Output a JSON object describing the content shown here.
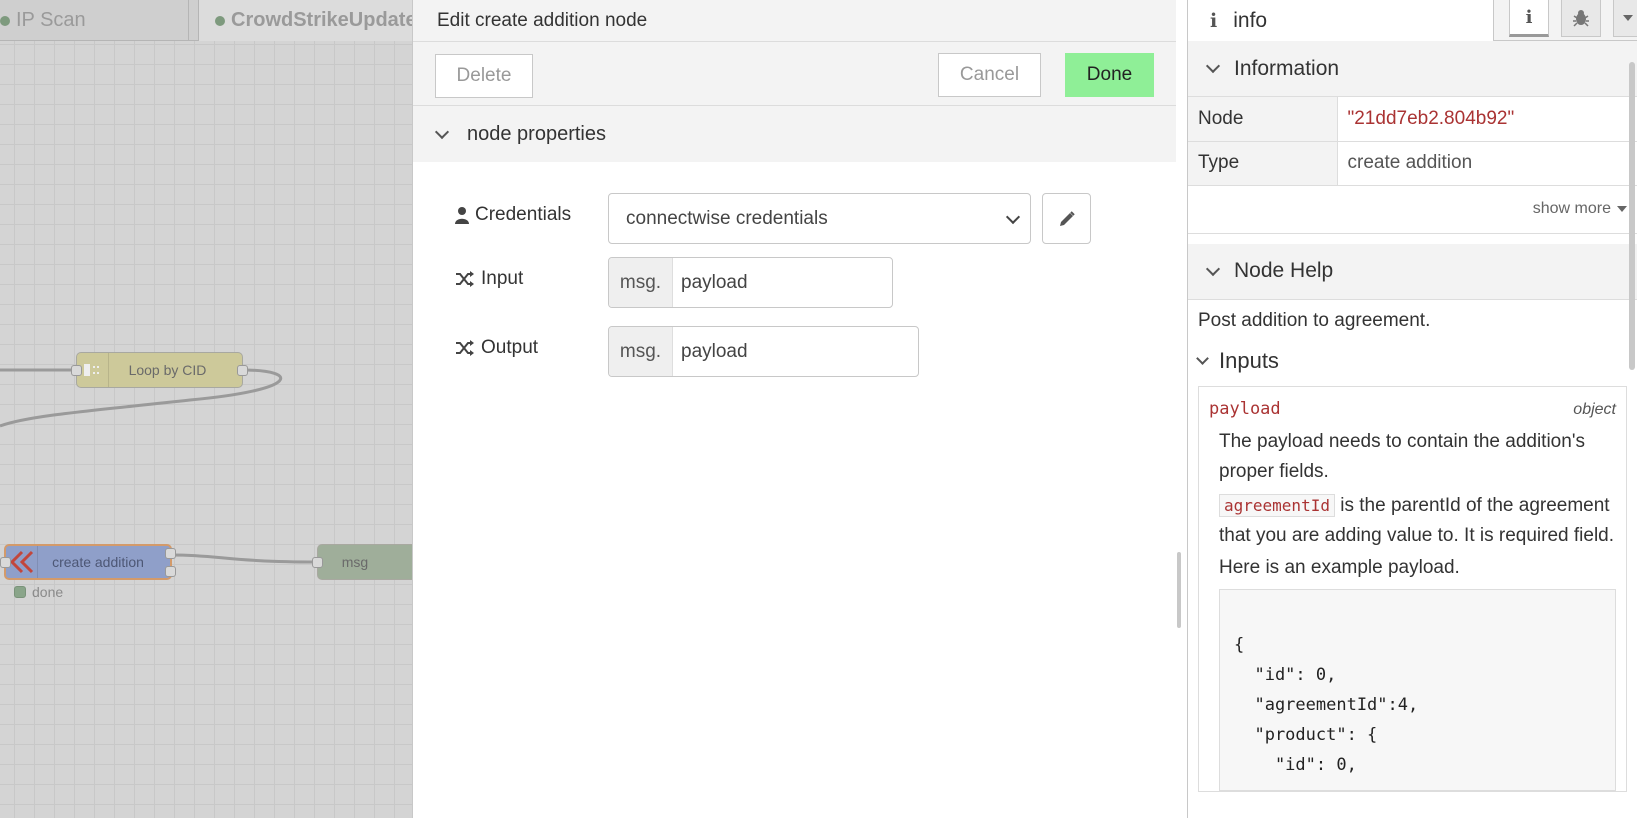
{
  "workspace": {
    "tabs": [
      {
        "label": "IP Scan"
      },
      {
        "label": "CrowdStrikeUpdate"
      }
    ],
    "nodes": {
      "loop": {
        "label": "Loop by CID"
      },
      "create": {
        "label": "create addition",
        "status": "done"
      },
      "msg": {
        "label": "msg"
      }
    }
  },
  "tray": {
    "title": "Edit create addition node",
    "delete_label": "Delete",
    "cancel_label": "Cancel",
    "done_label": "Done",
    "section_label": "node properties",
    "fields": {
      "credentials": {
        "label": "Credentials",
        "value": "connectwise credentials"
      },
      "input": {
        "label": "Input",
        "prefix": "msg.",
        "value": "payload"
      },
      "output": {
        "label": "Output",
        "prefix": "msg.",
        "value": "payload"
      }
    }
  },
  "sidebar": {
    "tab_label": "info",
    "information": {
      "title": "Information",
      "rows": [
        {
          "key": "Node",
          "value": "\"21dd7eb2.804b92\""
        },
        {
          "key": "Type",
          "value": "create addition"
        }
      ],
      "show_more": "show more"
    },
    "help": {
      "title": "Node Help",
      "intro": "Post addition to agreement.",
      "inputs_title": "Inputs",
      "prop_name": "payload",
      "prop_type": "object",
      "desc1": "The payload needs to contain the addition's proper fields.",
      "code_inline": "agreementId",
      "desc2": "is the parentId of the agreement that you are adding value to. It is required field.",
      "desc3": "Here is an example payload.",
      "code_block": "{\n  \"id\": 0,\n  \"agreementId\":4,\n  \"product\": {\n    \"id\": 0,"
    }
  },
  "colors": {
    "done_button": "#8fef97",
    "code_red": "#aa3333"
  }
}
